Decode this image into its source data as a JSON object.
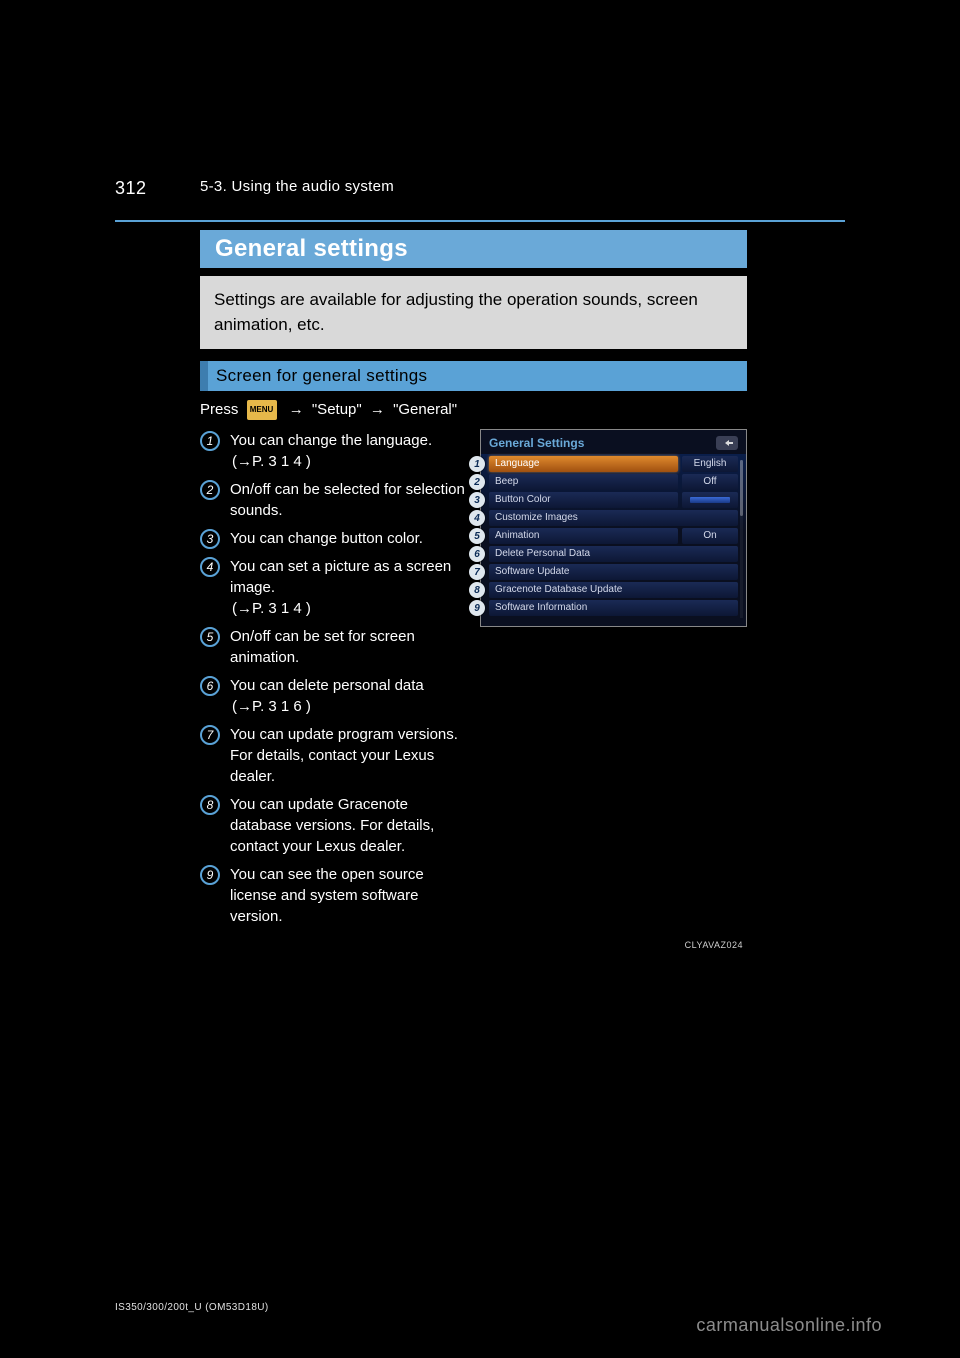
{
  "page": {
    "number": "312",
    "running_header": "5-3. Using the audio system"
  },
  "title": "General settings",
  "intro": "Settings are available for adjusting the operation sounds, screen animation, etc.",
  "section_label": "Screen for general settings",
  "instruction": {
    "prefix": "Press",
    "menu_label": "MENU",
    "arrow1": "→",
    "step2": "\"Setup\"",
    "arrow2": "→",
    "step3": "\"General\""
  },
  "items": [
    {
      "n": "1",
      "text": "You can change the language.",
      "ref": "(→P.  3 1 4 )"
    },
    {
      "n": "2",
      "text": "On/off can be selected for selection sounds."
    },
    {
      "n": "3",
      "text": "You can change button color."
    },
    {
      "n": "4",
      "text": "You can set a picture as a screen image.",
      "ref": "(→P.  3 1 4 )"
    },
    {
      "n": "5",
      "text": "On/off can be set for screen animation."
    },
    {
      "n": "6",
      "text": "You can delete personal data",
      "ref": "(→P.  3 1 6 )"
    },
    {
      "n": "7",
      "text": "You can update program versions. For details, contact your Lexus dealer."
    },
    {
      "n": "8",
      "text": "You can update Gracenote database versions. For details, contact your Lexus dealer."
    },
    {
      "n": "9",
      "text": "You can see the open source license and system software version."
    }
  ],
  "screenshot": {
    "title": "General Settings",
    "back_icon_name": "back-icon",
    "caption": "CLYAVAZ024",
    "rows": [
      {
        "n": "1",
        "label": "Language",
        "value": "English",
        "highlighted": true
      },
      {
        "n": "2",
        "label": "Beep",
        "value": "Off"
      },
      {
        "n": "3",
        "label": "Button Color",
        "value_swatch": true
      },
      {
        "n": "4",
        "label": "Customize Images"
      },
      {
        "n": "5",
        "label": "Animation",
        "value": "On"
      },
      {
        "n": "6",
        "label": "Delete Personal Data"
      },
      {
        "n": "7",
        "label": "Software Update"
      },
      {
        "n": "8",
        "label": "Gracenote Database Update"
      },
      {
        "n": "9",
        "label": "Software Information"
      }
    ]
  },
  "fineprint": "IS350/300/200t_U (OM53D18U)",
  "watermark": "carmanualsonline.info"
}
